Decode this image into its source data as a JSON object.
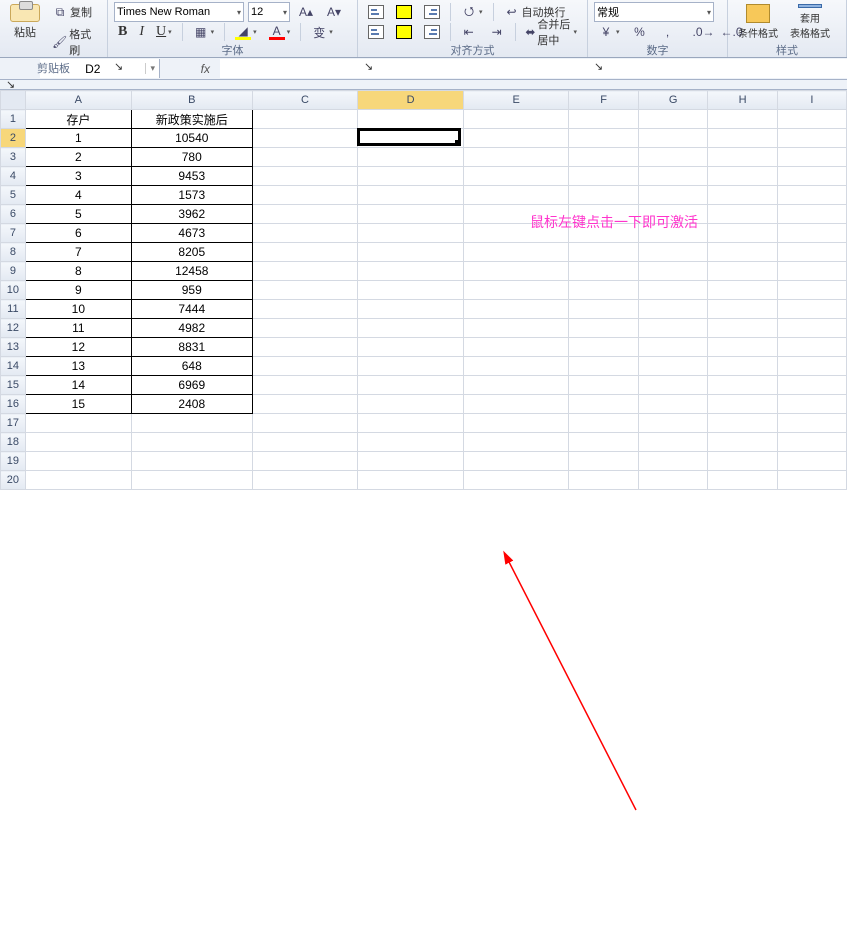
{
  "ribbon": {
    "clipboard": {
      "label": "剪贴板",
      "paste": "粘贴",
      "copy": "复制",
      "format_painter": "格式刷"
    },
    "font": {
      "label": "字体",
      "family": "Times New Roman",
      "size": "12",
      "bold": "B",
      "italic": "I",
      "underline": "U"
    },
    "align": {
      "label": "对齐方式",
      "wrap_text": "自动换行",
      "merge_center": "合并后居中"
    },
    "number": {
      "label": "数字",
      "format": "常规"
    },
    "styles": {
      "label": "样式",
      "cond_fmt": "条件格式",
      "table_fmt": "套用\n表格格式"
    }
  },
  "namebox": {
    "value": "D2"
  },
  "formula": {
    "value": ""
  },
  "columns": [
    "A",
    "B",
    "C",
    "D",
    "E",
    "F",
    "G",
    "H",
    "I"
  ],
  "row_count": 20,
  "headers": {
    "A": "存户",
    "B": "新政策实施后"
  },
  "table_rows": [
    {
      "a": "1",
      "b": "10540"
    },
    {
      "a": "2",
      "b": "780"
    },
    {
      "a": "3",
      "b": "9453"
    },
    {
      "a": "4",
      "b": "1573"
    },
    {
      "a": "5",
      "b": "3962"
    },
    {
      "a": "6",
      "b": "4673"
    },
    {
      "a": "7",
      "b": "8205"
    },
    {
      "a": "8",
      "b": "12458"
    },
    {
      "a": "9",
      "b": "959"
    },
    {
      "a": "10",
      "b": "7444"
    },
    {
      "a": "11",
      "b": "4982"
    },
    {
      "a": "12",
      "b": "8831"
    },
    {
      "a": "13",
      "b": "648"
    },
    {
      "a": "14",
      "b": "6969"
    },
    {
      "a": "15",
      "b": "2408"
    }
  ],
  "selected_cell": {
    "col": "D",
    "row": 2
  },
  "annotation": {
    "text": "鼠标左键点击一下即可激活",
    "color": "#ff33cc"
  },
  "chart_data": {
    "type": "table",
    "title": "",
    "columns": [
      "存户",
      "新政策实施后"
    ],
    "rows": [
      [
        1,
        10540
      ],
      [
        2,
        780
      ],
      [
        3,
        9453
      ],
      [
        4,
        1573
      ],
      [
        5,
        3962
      ],
      [
        6,
        4673
      ],
      [
        7,
        8205
      ],
      [
        8,
        12458
      ],
      [
        9,
        959
      ],
      [
        10,
        7444
      ],
      [
        11,
        4982
      ],
      [
        12,
        8831
      ],
      [
        13,
        648
      ],
      [
        14,
        6969
      ],
      [
        15,
        2408
      ]
    ]
  }
}
